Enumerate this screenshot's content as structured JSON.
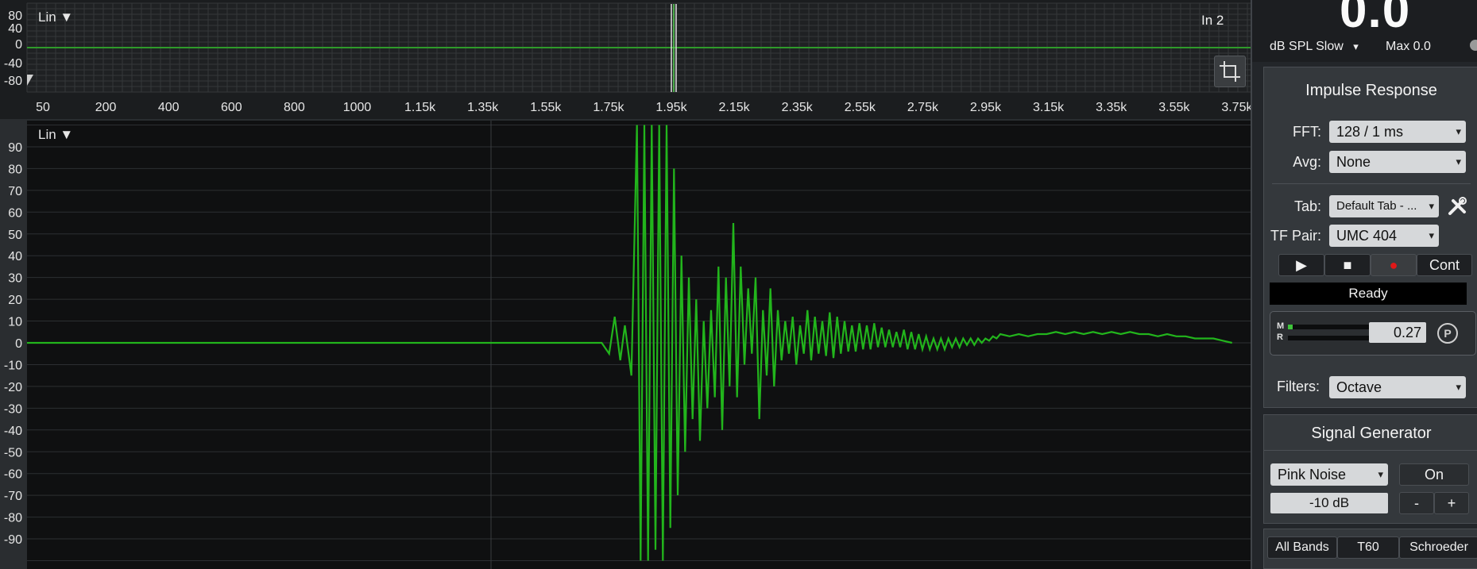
{
  "overview": {
    "mode_label": "Lin ▼",
    "channel_label": "In 2",
    "y_ticks": [
      "80",
      "40",
      "0",
      "-40",
      "-80"
    ],
    "x_ticks": [
      "50",
      "200",
      "400",
      "600",
      "800",
      "1000",
      "1.15k",
      "1.35k",
      "1.55k",
      "1.75k",
      "1.95k",
      "2.15k",
      "2.35k",
      "2.55k",
      "2.75k",
      "2.95k",
      "3.15k",
      "3.35k",
      "3.55k",
      "3.75k"
    ],
    "crop_icon": "crop-icon"
  },
  "main": {
    "mode_label": "Lin ▼",
    "y_ticks": [
      "90",
      "80",
      "70",
      "60",
      "50",
      "40",
      "30",
      "20",
      "10",
      "0",
      "-10",
      "-20",
      "-30",
      "-40",
      "-50",
      "-60",
      "-70",
      "-80",
      "-90"
    ],
    "trace_color": "#22b51c",
    "chart_data": {
      "type": "line",
      "ylim": [
        -100,
        100
      ],
      "series": [
        {
          "x": [
            0,
            100,
            200,
            300,
            400,
            500,
            600,
            620,
            628,
            634,
            640,
            645,
            652,
            658,
            662,
            666,
            670,
            674,
            678,
            682,
            686,
            690,
            694,
            698,
            702,
            706,
            710,
            714,
            718,
            722,
            726,
            730,
            734,
            738,
            742,
            746,
            750,
            754,
            758,
            762,
            766,
            770,
            774,
            778,
            782,
            786,
            790,
            794,
            798,
            802,
            806,
            810,
            814,
            818,
            822,
            826,
            830,
            834,
            838,
            842,
            846,
            850,
            854,
            858,
            862,
            866,
            870,
            874,
            878,
            882,
            886,
            890,
            894,
            898,
            902,
            906,
            910,
            914,
            918,
            922,
            926,
            930,
            934,
            938,
            942,
            946,
            950,
            954,
            958,
            962,
            966,
            970,
            974,
            978,
            982,
            986,
            990,
            994,
            998,
            1002,
            1006,
            1010,
            1014,
            1018,
            1022,
            1026,
            1030,
            1034,
            1038,
            1042,
            1046,
            1050,
            1060,
            1070,
            1080,
            1090,
            1100,
            1110,
            1120,
            1130,
            1140,
            1150,
            1160,
            1170,
            1180,
            1190,
            1200,
            1210,
            1220,
            1230,
            1240,
            1250,
            1260,
            1270,
            1280,
            1290,
            1300,
            1310,
            1320
          ],
          "y": [
            0,
            0,
            0,
            0,
            0,
            0,
            0,
            0,
            -5,
            12,
            -8,
            8,
            -15,
            100,
            -100,
            100,
            -100,
            100,
            -95,
            100,
            -100,
            100,
            -85,
            80,
            -70,
            40,
            -50,
            30,
            -35,
            20,
            -45,
            10,
            -30,
            15,
            -25,
            35,
            -40,
            30,
            -20,
            55,
            -25,
            35,
            -10,
            25,
            -5,
            30,
            -35,
            15,
            -15,
            25,
            -20,
            15,
            -8,
            10,
            -5,
            12,
            -10,
            8,
            -5,
            15,
            -8,
            12,
            -5,
            10,
            -6,
            14,
            -7,
            12,
            -5,
            10,
            -4,
            8,
            -4,
            9,
            -3,
            8,
            -3,
            9,
            -2,
            7,
            -2,
            6,
            -2,
            5,
            -2,
            6,
            -3,
            5,
            -3,
            4,
            -3,
            3,
            -3,
            2,
            -3,
            2,
            -3,
            2,
            -2,
            2,
            -2,
            2,
            -1,
            2,
            -1,
            2,
            0,
            2,
            1,
            3,
            2,
            4,
            3,
            4,
            3,
            4,
            4,
            5,
            4,
            5,
            4,
            5,
            4,
            5,
            4,
            5,
            4,
            4,
            3,
            4,
            3,
            3,
            2,
            2,
            2,
            1,
            0
          ]
        }
      ]
    }
  },
  "meter": {
    "value": "0.0",
    "mode": "dB SPL Slow",
    "mode_caret": "▾",
    "max": "Max 0.0"
  },
  "impulse": {
    "title": "Impulse Response",
    "fft_label": "FFT:",
    "fft_value": "128 / 1 ms",
    "avg_label": "Avg:",
    "avg_value": "None",
    "tab_label": "Tab:",
    "tab_value": "Default Tab - ...",
    "tf_label": "TF Pair:",
    "tf_value": "UMC 404",
    "play_icon": "▶",
    "stop_icon": "■",
    "record_icon": "●",
    "cont_label": "Cont",
    "status": "Ready",
    "level_m": "M",
    "level_r": "R",
    "level_m_fraction": 0.06,
    "level_r_fraction": 0.0,
    "level_value": "0.27",
    "p_label": "P",
    "filters_label": "Filters:",
    "filters_value": "Octave",
    "record_color": "#e01818",
    "level_color": "#3ec43a"
  },
  "siggen": {
    "title": "Signal Generator",
    "type_value": "Pink Noise",
    "on_label": "On",
    "level_value": "-10 dB",
    "minus_label": "-",
    "plus_label": "+"
  },
  "bands": {
    "all_bands": "All Bands",
    "t60": "T60",
    "schroeder": "Schroeder"
  }
}
